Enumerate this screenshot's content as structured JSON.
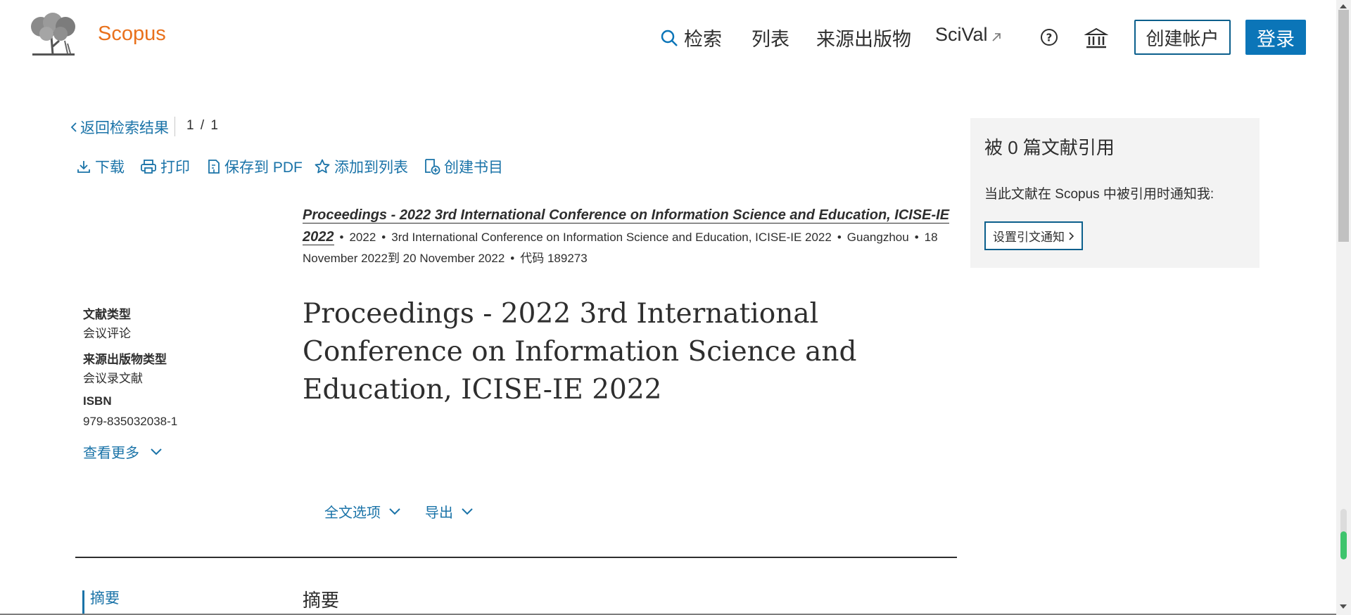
{
  "header": {
    "brand": "Scopus",
    "nav": {
      "search": "检索",
      "lists": "列表",
      "sources": "来源出版物",
      "scival": "SciVal"
    },
    "create_account": "创建帐户",
    "signin": "登录"
  },
  "back_row": {
    "back_label": "返回检索结果",
    "pager": "1 / 1"
  },
  "toolbar": {
    "download": "下载",
    "print": "打印",
    "save_pdf": "保存到 PDF",
    "add_to_list": "添加到列表",
    "create_bib": "创建书目"
  },
  "source": {
    "title": "Proceedings - 2022 3rd International Conference on Information Science and Education, ICISE-IE 2022",
    "year": "2022",
    "conference": "3rd International Conference on Information Science and Education, ICISE-IE 2022",
    "location": "Guangzhou",
    "dates": "18 November 2022到 20 November 2022",
    "code": "代码 189273"
  },
  "sidebar": {
    "doc_type_label": "文献类型",
    "doc_type_value": "会议评论",
    "src_type_label": "来源出版物类型",
    "src_type_value": "会议录文献",
    "isbn_label": "ISBN",
    "isbn_value": "979-835032038-1",
    "view_more": "查看更多"
  },
  "document": {
    "title": "Proceedings - 2022 3rd International Conference on Information Science and Education, ICISE-IE 2022"
  },
  "actions": {
    "fulltext_options": "全文选项",
    "export": "导出"
  },
  "abstract": {
    "nav_label": "摘要",
    "heading": "摘要"
  },
  "cited_panel": {
    "title": "被 0 篇文献引用",
    "notice": "当此文献在 Scopus 中被引用时通知我:",
    "alert_button": "设置引文通知"
  },
  "colors": {
    "brand": "#e9711c",
    "link": "#1a73a8",
    "primary_button": "#0b75b8",
    "progress": "#3ec46d"
  },
  "icons": [
    "logo-tree",
    "search-icon",
    "external-link-icon",
    "help-icon",
    "institution-icon",
    "chevron-left-icon",
    "download-icon",
    "print-icon",
    "pdf-icon",
    "star-icon",
    "bibliography-icon",
    "chevron-down-icon",
    "chevron-right-icon"
  ],
  "scroll_progress": 0.55
}
